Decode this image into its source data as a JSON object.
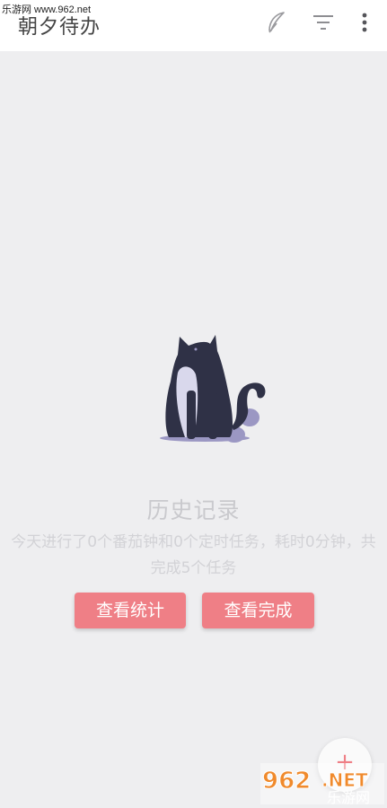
{
  "watermark_top": "乐游网 www.962.net",
  "app": {
    "title": "朝夕待办"
  },
  "toolbar": {
    "icons": [
      "feather-icon",
      "filter-icon",
      "more-vertical-icon"
    ]
  },
  "empty_state": {
    "title": "历史记录",
    "description": "今天进行了0个番茄钟和0个定时任务，耗时0分钟，共完成5个任务"
  },
  "buttons": {
    "view_stats": "查看统计",
    "view_completed": "查看完成"
  },
  "fab": {
    "label": "+"
  },
  "watermark_logo": {
    "number": "962",
    "net": ".NET",
    "name": "乐游网"
  },
  "colors": {
    "accent": "#ef7f86",
    "background": "#eeeef0",
    "topbar": "#ffffff"
  }
}
